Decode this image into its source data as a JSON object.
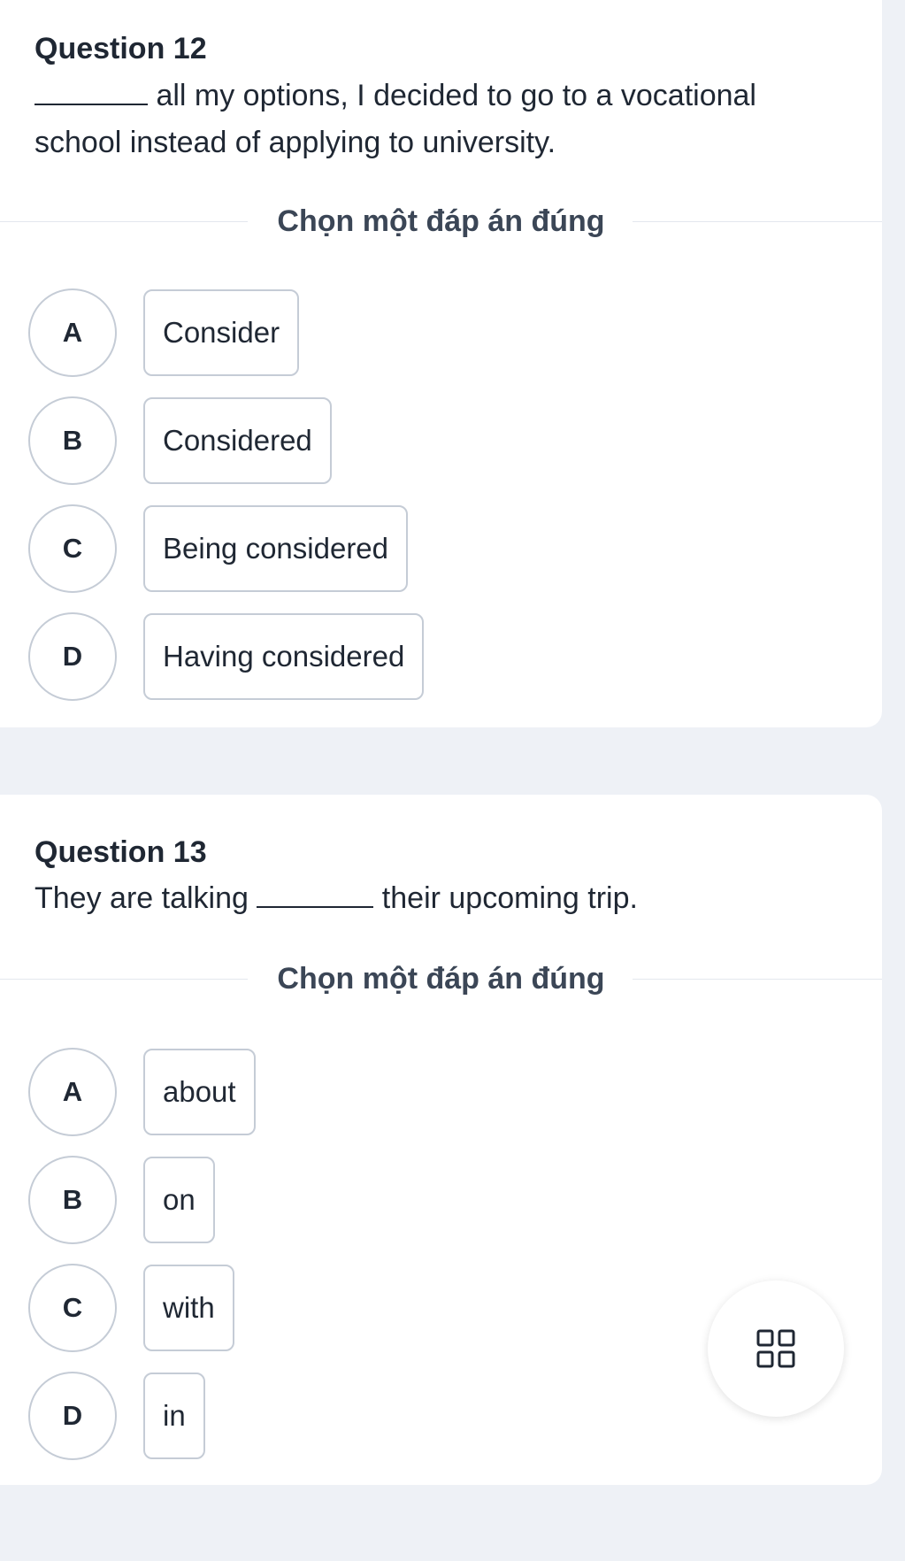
{
  "q12": {
    "title": "Question 12",
    "text_after_blank": " all my options, I decided to go to a vocational school instead of applying to university.",
    "prompt": "Chọn một đáp án đúng",
    "options": [
      {
        "letter": "A",
        "text": "Consider"
      },
      {
        "letter": "B",
        "text": "Considered"
      },
      {
        "letter": "C",
        "text": "Being considered"
      },
      {
        "letter": "D",
        "text": "Having considered"
      }
    ]
  },
  "q13": {
    "title": "Question 13",
    "text_before_blank": "They are talking ",
    "text_after_blank": " their upcoming trip.",
    "prompt": "Chọn một đáp án đúng",
    "options": [
      {
        "letter": "A",
        "text": "about"
      },
      {
        "letter": "B",
        "text": "on"
      },
      {
        "letter": "C",
        "text": "with"
      },
      {
        "letter": "D",
        "text": "in"
      }
    ]
  },
  "fab": {
    "icon": "grid-icon"
  }
}
